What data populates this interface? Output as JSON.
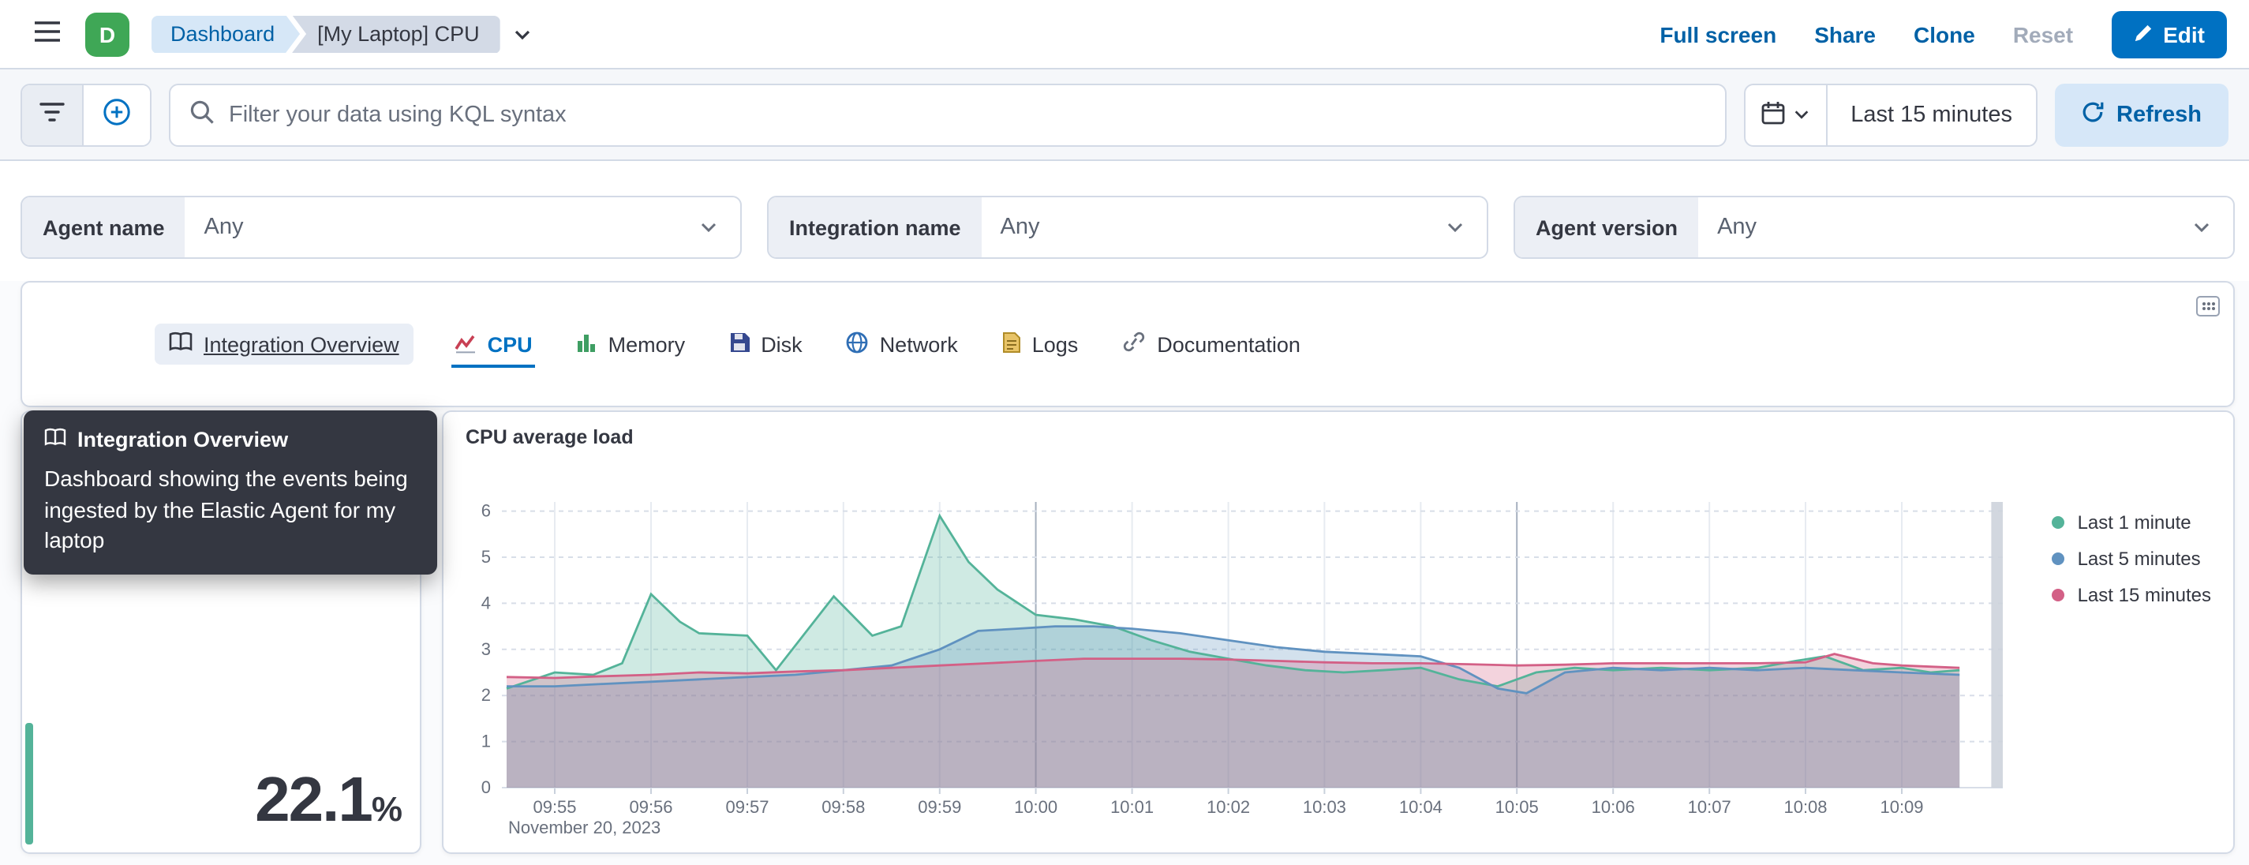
{
  "colors": {
    "primary": "#0071c2",
    "link": "#0061a6",
    "avatar_green": "#3fa756",
    "metric_accent": "#54b399"
  },
  "header": {
    "space_initial": "D",
    "breadcrumbs": {
      "root": "Dashboard",
      "current": "[My Laptop] CPU"
    },
    "actions": {
      "full_screen": "Full screen",
      "share": "Share",
      "clone": "Clone",
      "reset": "Reset",
      "edit": "Edit"
    }
  },
  "toolbar": {
    "search_placeholder": "Filter your data using KQL syntax",
    "time_range": "Last 15 minutes",
    "refresh_label": "Refresh"
  },
  "filters": [
    {
      "label": "Agent name",
      "value": "Any"
    },
    {
      "label": "Integration name",
      "value": "Any"
    },
    {
      "label": "Agent version",
      "value": "Any"
    }
  ],
  "tabs": [
    {
      "label": "Integration Overview",
      "state": "hovered"
    },
    {
      "label": "CPU",
      "state": "selected"
    },
    {
      "label": "Memory",
      "state": "default"
    },
    {
      "label": "Disk",
      "state": "default"
    },
    {
      "label": "Network",
      "state": "default"
    },
    {
      "label": "Logs",
      "state": "default"
    },
    {
      "label": "Documentation",
      "state": "default"
    }
  ],
  "tooltip": {
    "title": "Integration Overview",
    "body": "Dashboard showing the events being ingested by the Elastic Agent for my laptop"
  },
  "metric": {
    "value": "22.1",
    "unit": "%"
  },
  "chart_data": {
    "type": "area",
    "title": "CPU average load",
    "x_axis_date": "November 20, 2023",
    "x_unit": "minutes since 09:00",
    "x_domain": [
      54.45,
      70.05
    ],
    "ylim": [
      0,
      6.2
    ],
    "y_ticks": [
      0,
      1,
      2,
      3,
      4,
      5,
      6
    ],
    "grid": true,
    "legend_position": "right",
    "partial_bucket": [
      69.93,
      70.05
    ],
    "x_ticks": [
      {
        "m": 55,
        "label": "09:55"
      },
      {
        "m": 56,
        "label": "09:56"
      },
      {
        "m": 57,
        "label": "09:57"
      },
      {
        "m": 58,
        "label": "09:58"
      },
      {
        "m": 59,
        "label": "09:59"
      },
      {
        "m": 60,
        "label": "10:00",
        "major": true
      },
      {
        "m": 61,
        "label": "10:01"
      },
      {
        "m": 62,
        "label": "10:02"
      },
      {
        "m": 63,
        "label": "10:03"
      },
      {
        "m": 64,
        "label": "10:04"
      },
      {
        "m": 65,
        "label": "10:05",
        "major": true
      },
      {
        "m": 66,
        "label": "10:06"
      },
      {
        "m": 67,
        "label": "10:07"
      },
      {
        "m": 68,
        "label": "10:08"
      },
      {
        "m": 69,
        "label": "10:09"
      }
    ],
    "series": [
      {
        "name": "Last 1 minute",
        "color": "#54B399",
        "points": [
          [
            54.5,
            2.15
          ],
          [
            55,
            2.5
          ],
          [
            55.4,
            2.45
          ],
          [
            55.7,
            2.7
          ],
          [
            56,
            4.2
          ],
          [
            56.3,
            3.6
          ],
          [
            56.5,
            3.35
          ],
          [
            57,
            3.3
          ],
          [
            57.3,
            2.55
          ],
          [
            57.9,
            4.15
          ],
          [
            58.3,
            3.3
          ],
          [
            58.6,
            3.5
          ],
          [
            59,
            5.9
          ],
          [
            59.3,
            4.9
          ],
          [
            59.6,
            4.3
          ],
          [
            60,
            3.75
          ],
          [
            60.4,
            3.65
          ],
          [
            60.8,
            3.5
          ],
          [
            61.2,
            3.2
          ],
          [
            61.6,
            2.95
          ],
          [
            62,
            2.8
          ],
          [
            62.4,
            2.65
          ],
          [
            62.8,
            2.55
          ],
          [
            63.2,
            2.5
          ],
          [
            63.6,
            2.55
          ],
          [
            64,
            2.6
          ],
          [
            64.4,
            2.35
          ],
          [
            64.8,
            2.2
          ],
          [
            65.2,
            2.5
          ],
          [
            65.6,
            2.6
          ],
          [
            66,
            2.55
          ],
          [
            66.5,
            2.6
          ],
          [
            67,
            2.55
          ],
          [
            67.5,
            2.6
          ],
          [
            67.9,
            2.75
          ],
          [
            68.2,
            2.85
          ],
          [
            68.6,
            2.55
          ],
          [
            69,
            2.6
          ],
          [
            69.3,
            2.5
          ],
          [
            69.6,
            2.55
          ]
        ]
      },
      {
        "name": "Last 5 minutes",
        "color": "#6092C0",
        "points": [
          [
            54.5,
            2.2
          ],
          [
            55,
            2.2
          ],
          [
            55.5,
            2.25
          ],
          [
            56,
            2.3
          ],
          [
            56.5,
            2.35
          ],
          [
            57,
            2.4
          ],
          [
            57.5,
            2.45
          ],
          [
            58,
            2.55
          ],
          [
            58.5,
            2.65
          ],
          [
            59,
            3.0
          ],
          [
            59.4,
            3.4
          ],
          [
            59.8,
            3.45
          ],
          [
            60.2,
            3.5
          ],
          [
            60.6,
            3.5
          ],
          [
            61,
            3.45
          ],
          [
            61.5,
            3.35
          ],
          [
            62,
            3.2
          ],
          [
            62.5,
            3.05
          ],
          [
            63,
            2.95
          ],
          [
            63.5,
            2.9
          ],
          [
            64,
            2.85
          ],
          [
            64.4,
            2.6
          ],
          [
            64.8,
            2.15
          ],
          [
            65.1,
            2.05
          ],
          [
            65.5,
            2.5
          ],
          [
            66,
            2.6
          ],
          [
            66.5,
            2.55
          ],
          [
            67,
            2.6
          ],
          [
            67.5,
            2.55
          ],
          [
            68,
            2.6
          ],
          [
            68.5,
            2.55
          ],
          [
            69,
            2.5
          ],
          [
            69.6,
            2.45
          ]
        ]
      },
      {
        "name": "Last 15 minutes",
        "color": "#D36086",
        "points": [
          [
            54.5,
            2.4
          ],
          [
            55,
            2.38
          ],
          [
            55.5,
            2.42
          ],
          [
            56,
            2.45
          ],
          [
            56.5,
            2.5
          ],
          [
            57,
            2.48
          ],
          [
            57.5,
            2.52
          ],
          [
            58,
            2.55
          ],
          [
            58.5,
            2.6
          ],
          [
            59,
            2.65
          ],
          [
            59.5,
            2.7
          ],
          [
            60,
            2.75
          ],
          [
            60.5,
            2.8
          ],
          [
            61,
            2.8
          ],
          [
            61.5,
            2.8
          ],
          [
            62,
            2.78
          ],
          [
            62.5,
            2.75
          ],
          [
            63,
            2.72
          ],
          [
            63.5,
            2.7
          ],
          [
            64,
            2.7
          ],
          [
            64.5,
            2.68
          ],
          [
            65,
            2.65
          ],
          [
            65.5,
            2.67
          ],
          [
            66,
            2.7
          ],
          [
            66.5,
            2.7
          ],
          [
            67,
            2.7
          ],
          [
            67.5,
            2.7
          ],
          [
            68,
            2.72
          ],
          [
            68.3,
            2.9
          ],
          [
            68.7,
            2.7
          ],
          [
            69,
            2.65
          ],
          [
            69.6,
            2.6
          ]
        ]
      }
    ]
  }
}
